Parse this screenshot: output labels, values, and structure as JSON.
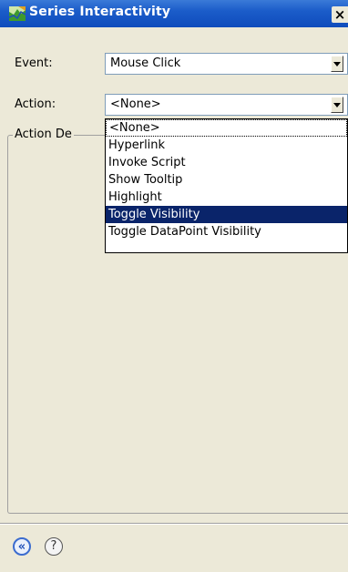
{
  "window": {
    "title": "Series Interactivity",
    "close_glyph": "×"
  },
  "form": {
    "event_label": "Event:",
    "event_value": "Mouse Click",
    "action_label": "Action:",
    "action_value": "<None>",
    "group_label": "Action De"
  },
  "dropdown": {
    "options": [
      "<None>",
      "Hyperlink",
      "Invoke Script",
      "Show Tooltip",
      "Highlight",
      "Toggle Visibility",
      "Toggle DataPoint Visibility"
    ],
    "highlighted_option": "Toggle Visibility"
  },
  "footer": {
    "back_glyph": "«",
    "help_glyph": "?"
  },
  "icons": {
    "app": "chart-app-icon",
    "close": "close-icon",
    "back": "back-arrows-icon",
    "help": "help-icon",
    "dropdown": "chevron-down-icon"
  },
  "colors": {
    "titlebar": "#0f4cbc",
    "window_bg": "#ece9d8",
    "selection": "#0a246a",
    "field_border": "#7f9db9"
  }
}
